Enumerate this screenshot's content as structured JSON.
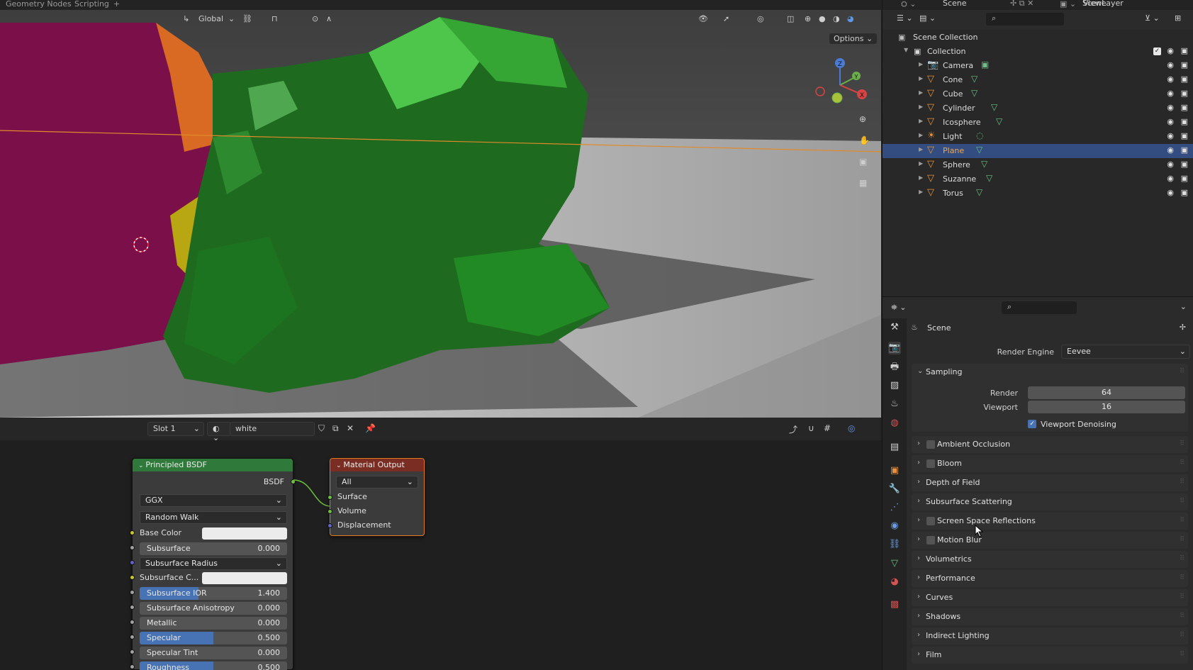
{
  "topbar": {
    "tab_geometry_nodes": "Geometry Nodes",
    "tab_scripting": "Scripting",
    "tab_add": "+",
    "scene_name": "Scene",
    "view_layer": "ViewLayer"
  },
  "viewport": {
    "orientation": "Global",
    "options_label": "Options",
    "gizmo": {
      "z": "Z",
      "y": "Y",
      "x": "X"
    }
  },
  "node_editor": {
    "slot": "Slot 1",
    "material_name": "white",
    "principled": {
      "title": "Principled BSDF",
      "output_socket": "BSDF",
      "distribution": "GGX",
      "subsurface_method": "Random Walk",
      "base_color_label": "Base Color",
      "subsurface_label": "Subsurface",
      "subsurface_value": "0.000",
      "subsurface_radius": "Subsurface Radius",
      "subsurface_color_label": "Subsurface C...",
      "subsurface_ior_label": "Subsurface IOR",
      "subsurface_ior_value": "1.400",
      "subsurface_ior_fill": 0.4,
      "subsurface_aniso_label": "Subsurface Anisotropy",
      "subsurface_aniso_value": "0.000",
      "metallic_label": "Metallic",
      "metallic_value": "0.000",
      "specular_label": "Specular",
      "specular_value": "0.500",
      "specular_fill": 0.5,
      "specular_tint_label": "Specular Tint",
      "specular_tint_value": "0.000",
      "roughness_label": "Roughness",
      "roughness_value": "0.500",
      "roughness_fill": 0.5
    },
    "material_output": {
      "title": "Material Output",
      "target": "All",
      "surface": "Surface",
      "volume": "Volume",
      "displacement": "Displacement"
    }
  },
  "outliner": {
    "root": "Scene Collection",
    "collection": "Collection",
    "items": [
      {
        "name": "Camera",
        "type": "camera"
      },
      {
        "name": "Cone",
        "type": "mesh"
      },
      {
        "name": "Cube",
        "type": "mesh"
      },
      {
        "name": "Cylinder",
        "type": "mesh"
      },
      {
        "name": "Icosphere",
        "type": "mesh"
      },
      {
        "name": "Light",
        "type": "light"
      },
      {
        "name": "Plane",
        "type": "mesh",
        "selected": true
      },
      {
        "name": "Sphere",
        "type": "mesh"
      },
      {
        "name": "Suzanne",
        "type": "mesh"
      },
      {
        "name": "Torus",
        "type": "mesh"
      }
    ]
  },
  "properties": {
    "context": "Scene",
    "render_engine_label": "Render Engine",
    "render_engine_value": "Eevee",
    "sampling": {
      "title": "Sampling",
      "render_label": "Render",
      "render_value": "64",
      "viewport_label": "Viewport",
      "viewport_value": "16",
      "denoise_label": "Viewport Denoising",
      "denoise_checked": true
    },
    "panels": [
      {
        "label": "Ambient Occlusion",
        "checkbox": true
      },
      {
        "label": "Bloom",
        "checkbox": true
      },
      {
        "label": "Depth of Field",
        "checkbox": false
      },
      {
        "label": "Subsurface Scattering",
        "checkbox": false
      },
      {
        "label": "Screen Space Reflections",
        "checkbox": true
      },
      {
        "label": "Motion Blur",
        "checkbox": true
      },
      {
        "label": "Volumetrics",
        "checkbox": false
      },
      {
        "label": "Performance",
        "checkbox": false
      },
      {
        "label": "Curves",
        "checkbox": false
      },
      {
        "label": "Shadows",
        "checkbox": false
      },
      {
        "label": "Indirect Lighting",
        "checkbox": false
      },
      {
        "label": "Film",
        "checkbox": false
      }
    ]
  },
  "colors": {
    "selected_row": "#334d80",
    "accent_blue": "#4772b3",
    "node_bsdf_header": "#2f7a3a",
    "node_output_header": "#7a2d22",
    "active_outline": "#e07a1a"
  }
}
